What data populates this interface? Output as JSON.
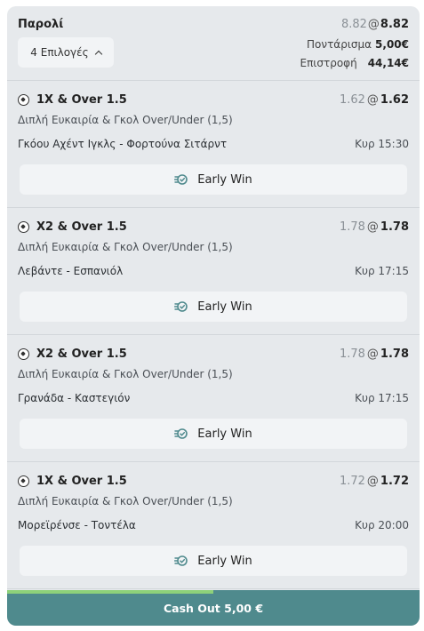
{
  "header": {
    "title": "Παρολί",
    "odds_old": "8.82",
    "odds_at": "@",
    "odds_new": "8.82",
    "selections_label": "4 Επιλογές",
    "stake_label": "Ποντάρισμα",
    "stake_value": "5,00€",
    "return_label": "Επιστροφή",
    "return_value": "44,14€"
  },
  "bets": [
    {
      "title": "1X & Over 1.5",
      "odds_old": "1.62",
      "odds_new": "1.62",
      "market": "Διπλή Ευκαιρία & Γκολ Over/Under (1,5)",
      "match": "Γκόου Αχέντ Ιγκλς - Φορτούνα Σιτάρντ",
      "time": "Κυρ 15:30",
      "early_win": "Early Win"
    },
    {
      "title": "X2 & Over 1.5",
      "odds_old": "1.78",
      "odds_new": "1.78",
      "market": "Διπλή Ευκαιρία & Γκολ Over/Under (1,5)",
      "match": "Λεβάντε - Εσπανιόλ",
      "time": "Κυρ 17:15",
      "early_win": "Early Win"
    },
    {
      "title": "X2 & Over 1.5",
      "odds_old": "1.78",
      "odds_new": "1.78",
      "market": "Διπλή Ευκαιρία & Γκολ Over/Under (1,5)",
      "match": "Γρανάδα - Καστεγιόν",
      "time": "Κυρ 17:15",
      "early_win": "Early Win"
    },
    {
      "title": "1X & Over 1.5",
      "odds_old": "1.72",
      "odds_new": "1.72",
      "market": "Διπλή Ευκαιρία & Γκολ Over/Under (1,5)",
      "match": "Μορεϊρένσε - Τοντέλα",
      "time": "Κυρ 20:00",
      "early_win": "Early Win"
    }
  ],
  "icons": {
    "sport": "football-icon",
    "early_win": "early-win-icon",
    "toggle": "chevron-up-icon"
  },
  "cashout": {
    "label": "Cash Out 5,00 €",
    "progress_fraction": 0.5
  },
  "colors": {
    "card_bg": "#e6e9ec",
    "button_bg": "#f2f4f6",
    "cashout_bg": "#4f8a8d",
    "progress": "#8ed17a",
    "early_win_icon": "#4f8a8d"
  }
}
